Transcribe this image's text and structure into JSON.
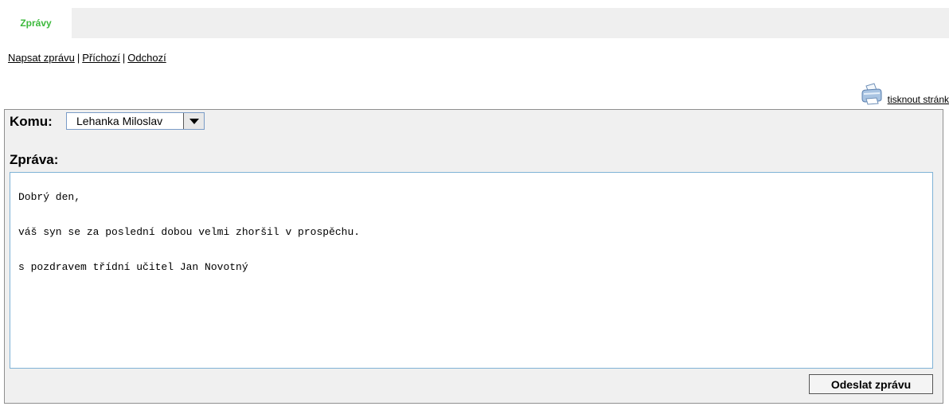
{
  "tabs": [
    {
      "label": "Zprávy",
      "active": true
    }
  ],
  "subnav": {
    "compose": "Napsat zprávu",
    "separator": "|",
    "inbox": "Příchozí",
    "outbox": "Odchozí"
  },
  "print": {
    "label": "tisknout stránk",
    "icon": "printer-icon"
  },
  "form": {
    "recipient_label": "Komu:",
    "recipient_value": "Lehanka Miloslav",
    "message_label": "Zpráva:",
    "message_lines": [
      "Dobrý den,",
      "váš syn se za poslední dobou velmi zhoršil v prospěchu.",
      "s pozdravem třídní učitel Jan Novotný"
    ],
    "send_label": "Odeslat zprávu"
  },
  "colors": {
    "tab_text": "#3cb93c",
    "tabbar_bg": "#efefef",
    "panel_bg": "#f0f0f0",
    "field_border": "#7fb2d6"
  }
}
